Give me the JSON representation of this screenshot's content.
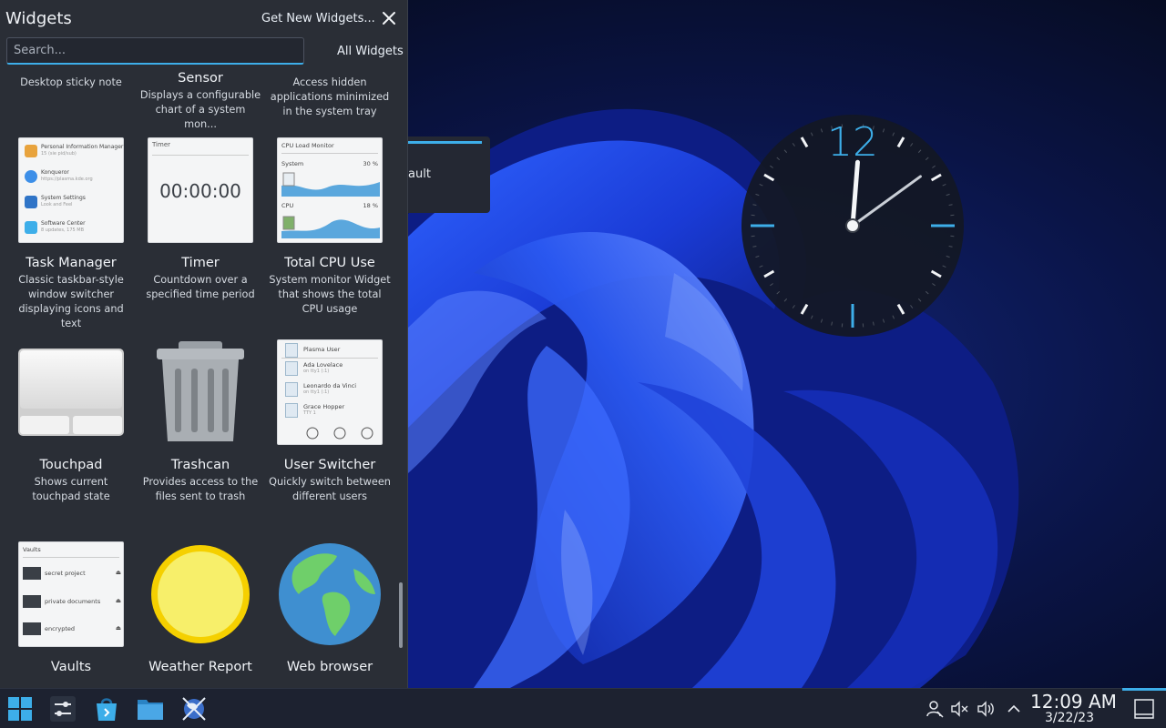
{
  "panel": {
    "title": "Widgets",
    "get_new_label": "Get New Widgets...",
    "search_placeholder": "Search...",
    "filter_label": "All Widgets"
  },
  "widgets": [
    {
      "name": "",
      "desc": "Desktop sticky note"
    },
    {
      "name": "Sensor",
      "desc": "Displays a configurable chart of a system mon..."
    },
    {
      "name": "",
      "desc": "Access hidden applications minimized in the system tray"
    },
    {
      "name": "Task Manager",
      "desc": "Classic taskbar-style window switcher displaying icons and text"
    },
    {
      "name": "Timer",
      "desc": "Countdown over a specified time period"
    },
    {
      "name": "Total CPU Use",
      "desc": "System monitor Widget that shows the total CPU usage"
    },
    {
      "name": "Touchpad",
      "desc": "Shows current touchpad state"
    },
    {
      "name": "Trashcan",
      "desc": "Provides access to the files sent to trash"
    },
    {
      "name": "User Switcher",
      "desc": "Quickly switch between different users"
    },
    {
      "name": "Vaults",
      "desc": ""
    },
    {
      "name": "Weather Report",
      "desc": ""
    },
    {
      "name": "Web browser",
      "desc": ""
    }
  ],
  "thumbs": {
    "task_manager": [
      {
        "l1": "Personal Information Manager",
        "l2": "15 (sie pid/sub)",
        "color": "#e8a33d"
      },
      {
        "l1": "Konqueror",
        "l2": "https://plasma.kde.org",
        "color": "#3d8fe8"
      },
      {
        "l1": "System Settings",
        "l2": "Look and Feel",
        "color": "#2f74c7"
      },
      {
        "l1": "Software Center",
        "l2": "8 updates, 175 MB",
        "color": "#3daee9"
      }
    ],
    "timer": {
      "header": "Timer",
      "value": "00:00:00"
    },
    "cpu": {
      "header": "CPU Load Monitor",
      "row1": "System",
      "row1_val": "30 %",
      "row2": "CPU",
      "row2_val": "18 %"
    },
    "user_switcher": {
      "header": "Plasma User",
      "users": [
        {
          "name": "Ada Lovelace",
          "sub": "on tty1 (:1)"
        },
        {
          "name": "Leonardo da Vinci",
          "sub": "on tty1 (:1)"
        },
        {
          "name": "Grace Hopper",
          "sub": "TTY 1"
        }
      ]
    },
    "vaults": {
      "header": "Vaults",
      "items": [
        "secret project",
        "private documents",
        "encrypted"
      ]
    }
  },
  "dialog": {
    "text": "ault"
  },
  "clock": {
    "hour": 12,
    "minute": 9,
    "twelve_label": "12",
    "accent": "#3daee9"
  },
  "taskbar": {
    "time": "12:09 AM",
    "date": "3/22/23"
  },
  "colors": {
    "accent": "#3daee9",
    "panel_bg": "#2a2e36",
    "taskbar_bg": "#1d2230"
  }
}
